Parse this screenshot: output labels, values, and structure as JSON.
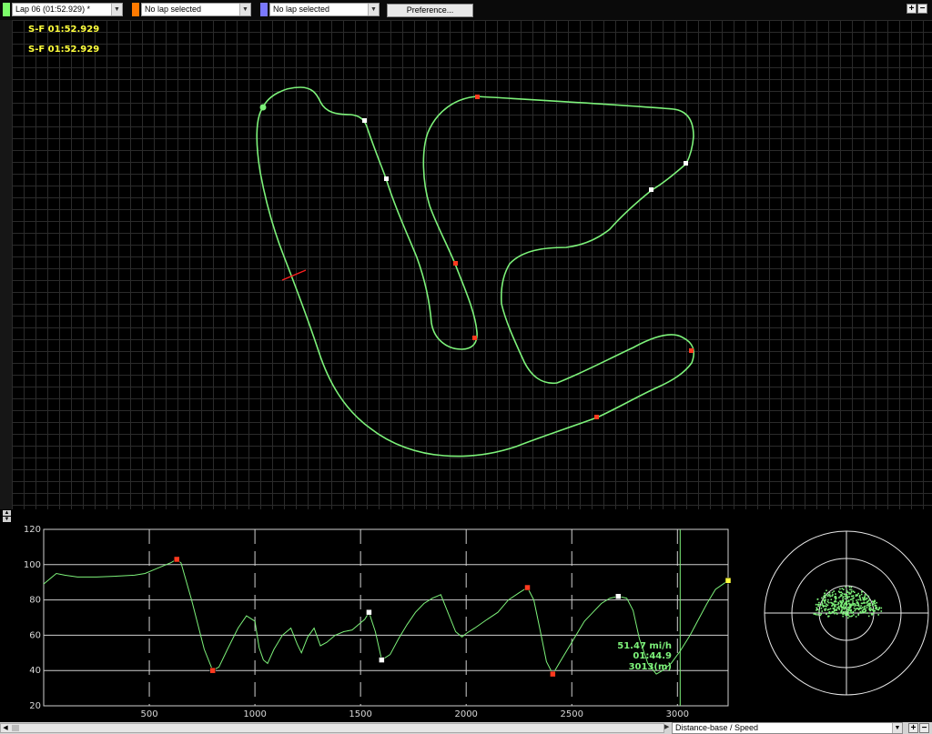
{
  "toolbar": {
    "lap_select": {
      "value": "Lap 06    (01:52.929) *",
      "color": "#7cfc6a"
    },
    "compare_lap_1": {
      "value": "No lap selected",
      "color": "#ff7a00"
    },
    "compare_lap_2": {
      "value": "No lap selected",
      "color": "#7a78ff"
    },
    "preference_label": "Preference...",
    "plus_label": "+",
    "minus_label": "−"
  },
  "map": {
    "sector_times": [
      "S-F  01:52.929",
      "S-F  01:52.929"
    ],
    "track_color": "#7df27a",
    "grid": true
  },
  "graph": {
    "type": "line",
    "y_ticks": [
      "120",
      "100",
      "80",
      "60",
      "40",
      "20"
    ],
    "x_ticks": [
      "500",
      "1000",
      "1500",
      "2000",
      "2500",
      "3000"
    ],
    "ylim": [
      20,
      120
    ],
    "xlim": [
      0,
      3240
    ],
    "cursor_readout": {
      "speed": "51.47 mi/h",
      "time": "01:44.9",
      "distance": "3013(m)"
    }
  },
  "chart_data": {
    "type": "line",
    "xlabel": "",
    "ylabel": "",
    "xlim": [
      0,
      3240
    ],
    "ylim": [
      20,
      120
    ],
    "grid": true,
    "series": [
      {
        "color": "#7df27a",
        "x": [
          0,
          30,
          60,
          100,
          160,
          250,
          350,
          430,
          480,
          520,
          560,
          600,
          630,
          650,
          700,
          760,
          800,
          830,
          870,
          920,
          960,
          1000,
          1020,
          1040,
          1060,
          1090,
          1130,
          1170,
          1200,
          1220,
          1250,
          1280,
          1310,
          1340,
          1380,
          1420,
          1460,
          1490,
          1520,
          1540,
          1570,
          1600,
          1640,
          1680,
          1720,
          1760,
          1800,
          1840,
          1880,
          1920,
          1950,
          1980,
          2000,
          2040,
          2100,
          2150,
          2200,
          2250,
          2290,
          2320,
          2350,
          2380,
          2410,
          2440,
          2480,
          2520,
          2560,
          2600,
          2640,
          2680,
          2720,
          2760,
          2790,
          2820,
          2860,
          2900,
          2930,
          2970,
          3013,
          3060,
          3100,
          3140,
          3180,
          3240
        ],
        "y": [
          89,
          92,
          95,
          94,
          93,
          93,
          93.5,
          94,
          95,
          97,
          99,
          101,
          103,
          101,
          80,
          52,
          40,
          42,
          52,
          64,
          71,
          68,
          53,
          46,
          44,
          52,
          60,
          64,
          55,
          50,
          59,
          64,
          54,
          56,
          60,
          62,
          63,
          66,
          69,
          73,
          62,
          46,
          49,
          58,
          66,
          73,
          78,
          81,
          83,
          71,
          62,
          59,
          61,
          64,
          69,
          73,
          80,
          84,
          87,
          80,
          63,
          45,
          38,
          44,
          52,
          60,
          68,
          73,
          78,
          81,
          82,
          81,
          74,
          58,
          44,
          38,
          40,
          44,
          51,
          60,
          69,
          78,
          86,
          91
        ]
      }
    ],
    "markers": [
      {
        "x": 630,
        "y": 103,
        "color": "#ff3a1f"
      },
      {
        "x": 800,
        "y": 40,
        "color": "#ff3a1f"
      },
      {
        "x": 1540,
        "y": 73,
        "color": "#ffffff"
      },
      {
        "x": 1600,
        "y": 46,
        "color": "#ffffff"
      },
      {
        "x": 2290,
        "y": 87,
        "color": "#ff3a1f"
      },
      {
        "x": 2410,
        "y": 38,
        "color": "#ff3a1f"
      },
      {
        "x": 2720,
        "y": 82,
        "color": "#ffffff"
      },
      {
        "x": 3240,
        "y": 91,
        "color": "#ffff3c"
      }
    ],
    "cursor_x": 3013
  },
  "bottom": {
    "view_select": "Distance-base / Speed",
    "plus_label": "+",
    "minus_label": "−"
  }
}
